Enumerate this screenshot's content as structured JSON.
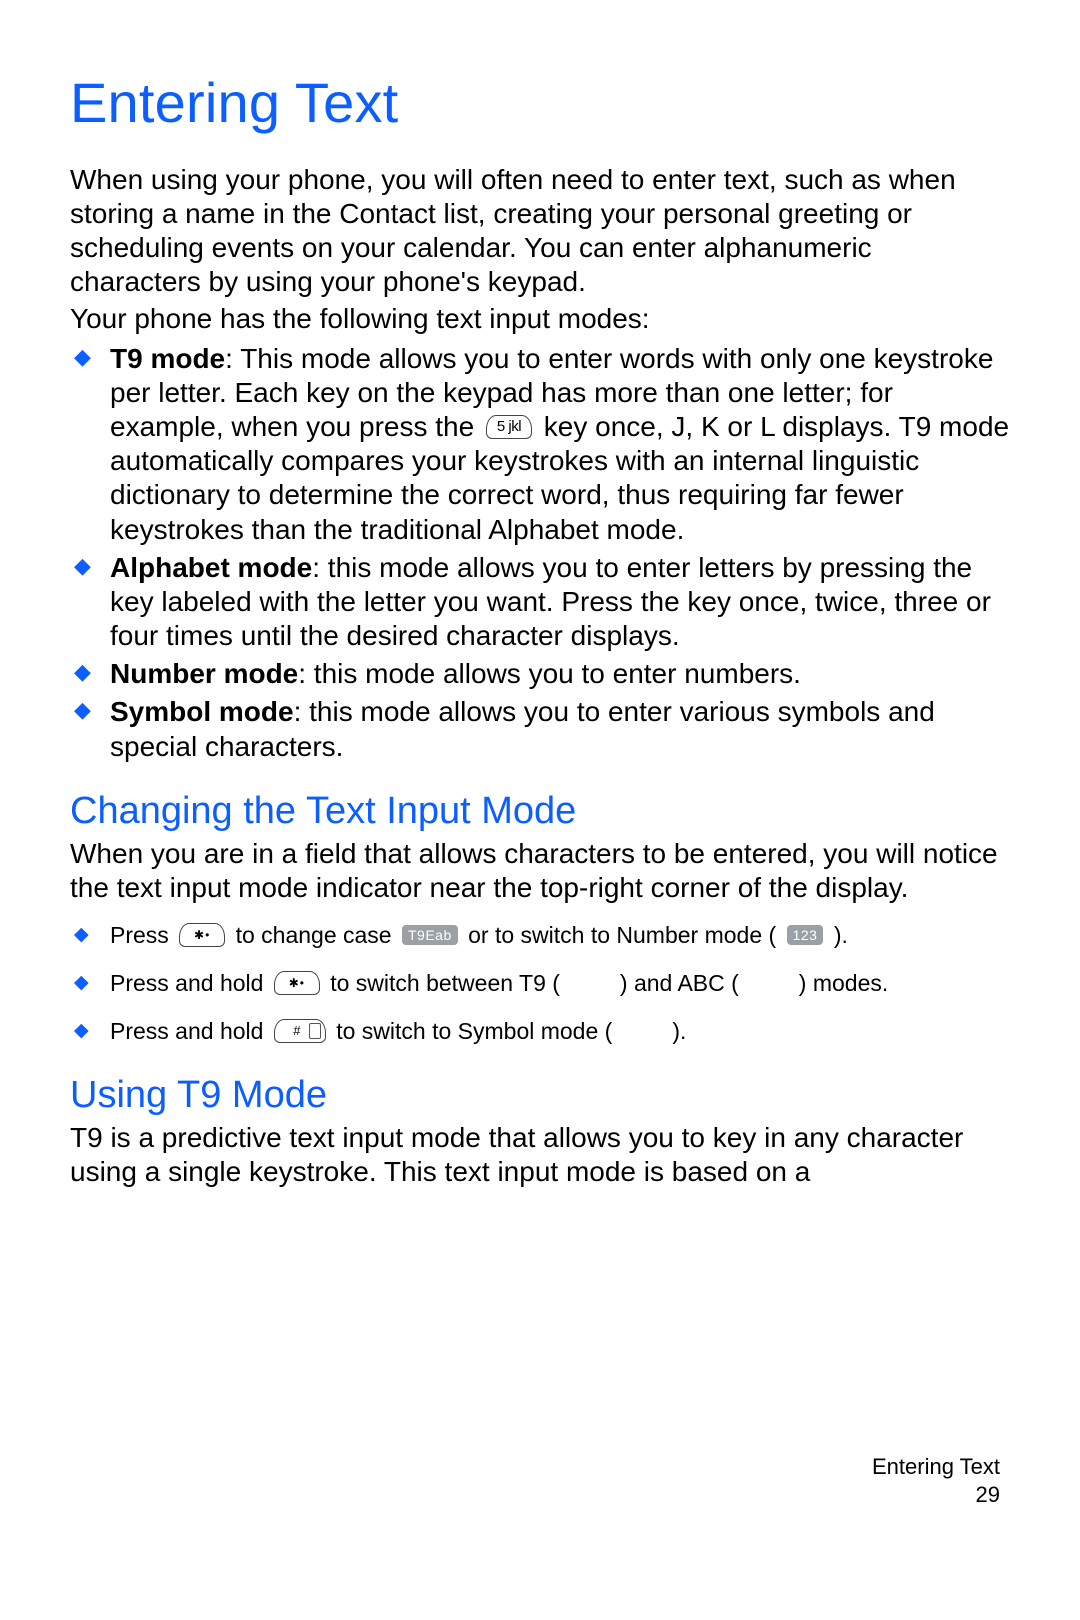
{
  "title": "Entering Text",
  "intro1": "When using your phone, you will often need to enter text, such as when storing a name in the Contact list, creating your personal greeting or scheduling events on your calendar. You can enter alphanumeric characters by using your phone's keypad.",
  "intro2": "Your phone has the following text input modes:",
  "modes": {
    "t9_label": "T9 mode",
    "t9_pre": ": This mode allows you to enter words with only one keystroke per letter. Each key on the keypad has more than one letter; for example, when you press the ",
    "t9_post": " key once, J, K or L displays. T9 mode automatically compares your keystrokes with an internal linguistic dictionary to determine the correct word, thus requiring far fewer keystrokes than the traditional Alphabet mode.",
    "alpha_label": "Alphabet mode",
    "alpha_text": ": this mode allows you to enter letters by pressing the key labeled with the letter you want. Press the key once, twice, three or four times until the desired character displays.",
    "num_label": "Number mode",
    "num_text": ": this mode allows you to enter numbers.",
    "sym_label": "Symbol mode",
    "sym_text": ": this mode allows you to enter various symbols and special characters."
  },
  "section_change": "Changing the Text Input Mode",
  "change_intro": "When you are in a field that allows characters to be entered, you will notice the text input mode indicator near the top-right corner of the display.",
  "change": {
    "l1a": "Press ",
    "l1b": " to change case ",
    "l1c": " or to switch to Number mode ( ",
    "l1d": " ).",
    "l2a": "Press and hold ",
    "l2b": " to switch between T9 (",
    "l2c": ") and ABC (",
    "l2d": ") modes.",
    "l3a": "Press and hold ",
    "l3b": " to switch to Symbol mode (",
    "l3c": ").",
    "badge_case": "T9Eab",
    "badge_num": "123"
  },
  "section_t9": "Using T9 Mode",
  "t9_intro": "T9 is a predictive text input mode that allows you to key in any character using a single keystroke. This text input mode is based on a",
  "footer_title": "Entering Text",
  "footer_page": "29"
}
